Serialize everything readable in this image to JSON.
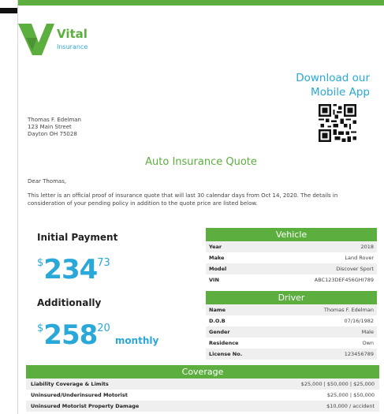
{
  "brand": {
    "name": "Vital",
    "sub": "Insurance",
    "green": "#5cae3f",
    "blue": "#2aa8d8"
  },
  "app": {
    "line1": "Download our",
    "line2": "Mobile App",
    "qr_icon": "qr-code"
  },
  "address": {
    "name": "Thomas F. Edelman",
    "street": "123 Main Street",
    "city": "Dayton OH 75028"
  },
  "title": "Auto Insurance Quote",
  "greeting": "Dear Thomas,",
  "intro": "This letter is an official proof of insurance quote that will last 30 calendar days from Oct 14, 2020.  The details in consideration of your pending policy in addition to the quote price are listed below.",
  "initial": {
    "label": "Initial Payment",
    "dollar": "$",
    "whole": "234",
    "cents": "73"
  },
  "additional": {
    "label": "Additionally",
    "dollar": "$",
    "whole": "258",
    "cents": "20",
    "unit": "monthly"
  },
  "vehicle": {
    "title": "Vehicle",
    "rows": [
      {
        "k": "Year",
        "v": "2018"
      },
      {
        "k": "Make",
        "v": "Land Rover"
      },
      {
        "k": "Model",
        "v": "Discover Sport"
      },
      {
        "k": "VIN",
        "v": "ABC123DEF456GHI789"
      }
    ]
  },
  "driver": {
    "title": "Driver",
    "rows": [
      {
        "k": "Name",
        "v": "Thomas F. Edelman"
      },
      {
        "k": "D.O.B",
        "v": "07/16/1982"
      },
      {
        "k": "Gender",
        "v": "Male"
      },
      {
        "k": "Residence",
        "v": "Own"
      },
      {
        "k": "License No.",
        "v": "123456789"
      }
    ]
  },
  "coverage": {
    "title": "Coverage",
    "rows": [
      {
        "k": "Liability Coverage & Limits",
        "v": "$25,000 | $50,000 | $25,000"
      },
      {
        "k": "Uninsured/Underinsured Motorist",
        "v": "$25,000 | $50,000"
      },
      {
        "k": "Uninsured Motorist Property Damage",
        "v": "$10,000 / accident"
      }
    ]
  }
}
